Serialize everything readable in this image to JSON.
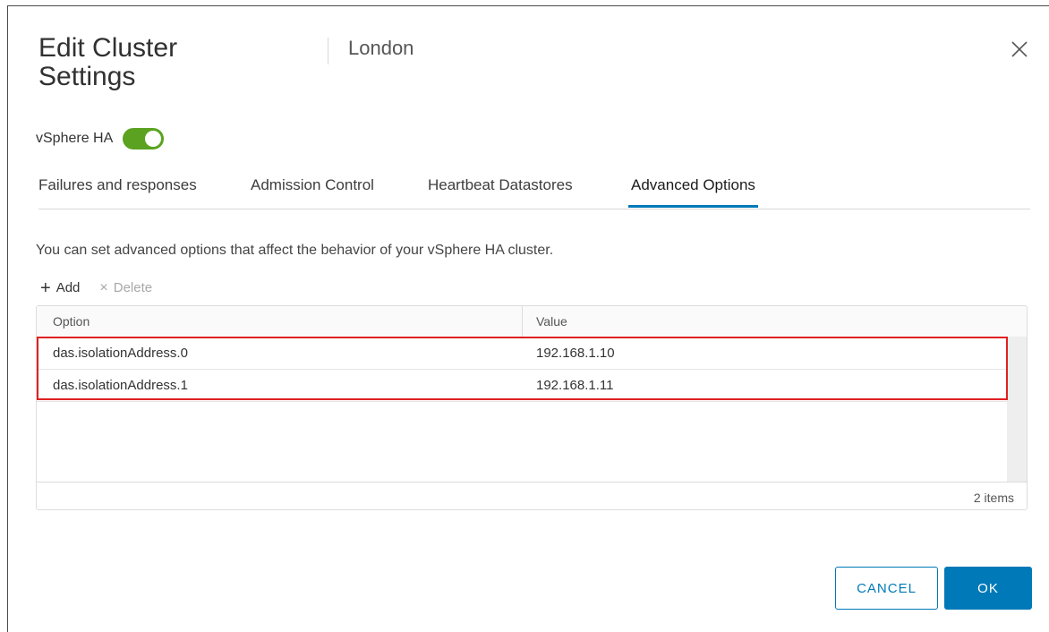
{
  "dialog": {
    "title": "Edit Cluster Settings",
    "subtitle": "London",
    "close_icon": "close-icon"
  },
  "ha": {
    "label": "vSphere HA",
    "enabled": true,
    "toggle_color": "#5aa220"
  },
  "tabs": [
    {
      "label": "Failures and responses",
      "active": false
    },
    {
      "label": "Admission Control",
      "active": false
    },
    {
      "label": "Heartbeat Datastores",
      "active": false
    },
    {
      "label": "Advanced Options",
      "active": true
    }
  ],
  "description": "You can set advanced options that affect the behavior of your vSphere HA cluster.",
  "toolbar": {
    "add_label": "Add",
    "add_icon": "plus-icon",
    "delete_label": "Delete",
    "delete_icon": "x-icon"
  },
  "table": {
    "columns": [
      "Option",
      "Value"
    ],
    "rows": [
      {
        "option": "das.isolationAddress.0",
        "value": "192.168.1.10"
      },
      {
        "option": "das.isolationAddress.1",
        "value": "192.168.1.11"
      }
    ],
    "footer": "2 items"
  },
  "buttons": {
    "cancel": "CANCEL",
    "ok": "OK"
  },
  "colors": {
    "accent": "#0079b8",
    "highlight": "#e02020"
  }
}
